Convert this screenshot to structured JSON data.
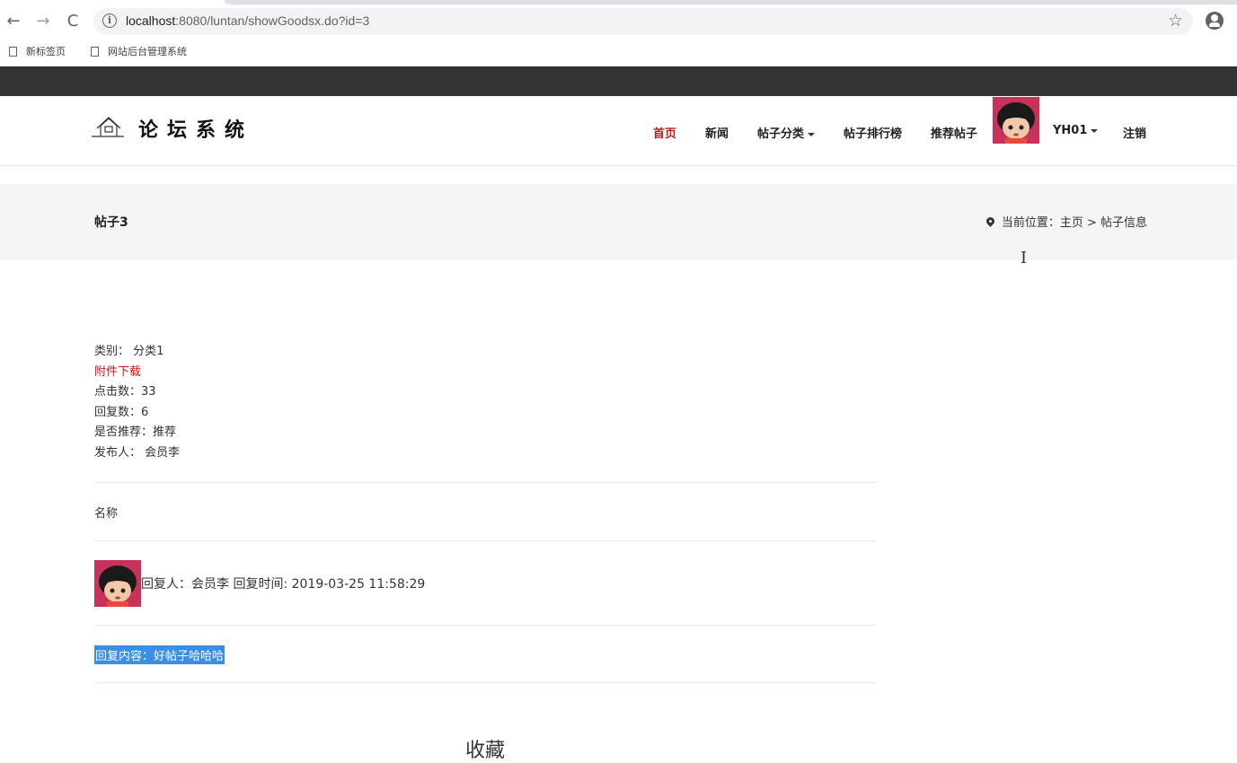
{
  "browser": {
    "url_host": "localhost",
    "url_rest": ":8080/luntan/showGoodsx.do?id=3",
    "bookmarks": [
      "新标签页",
      "网站后台管理系统"
    ]
  },
  "site": {
    "logo_text": "论坛系统",
    "nav": {
      "home": "首页",
      "news": "新闻",
      "categories": "帖子分类",
      "ranking": "帖子排行榜",
      "recommended": "推荐帖子",
      "username": "YH01",
      "logout": "注销"
    }
  },
  "post": {
    "title": "帖子3",
    "breadcrumb": "当前位置：主页 > 帖子信息",
    "category": "类别： 分类1",
    "attachment": "附件下载",
    "clicks": "点击数：33",
    "replies": "回复数：6",
    "recommended": "是否推荐：推荐",
    "author": "发布人： 会员李",
    "name_label": "名称"
  },
  "reply": {
    "meta": "回复人：会员李 回复时间: 2019-03-25 11:58:29",
    "content": "回复内容：好帖子哈哈哈"
  },
  "favorite_label": "收藏",
  "colors": {
    "accent": "#c0171d",
    "selection": "#3a8ee6",
    "topbar": "#333333"
  }
}
